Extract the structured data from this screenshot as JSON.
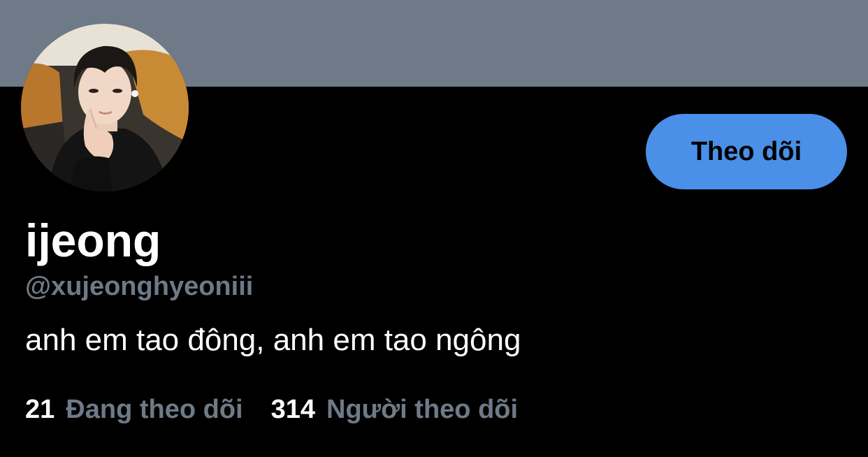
{
  "profile": {
    "display_name": "ijeong",
    "handle": "@xujeonghyeoniii",
    "bio": "anh em tao đông, anh em tao ngông",
    "follow_button_label": "Theo dõi",
    "following_count": "21",
    "following_label": "Đang theo dõi",
    "followers_count": "314",
    "followers_label": "Người theo dõi"
  },
  "colors": {
    "banner": "#6e7a87",
    "background": "#000000",
    "accent_button": "#4a8fe8",
    "muted_text": "#6e7a87",
    "primary_text": "#ffffff"
  },
  "icons": {
    "avatar": "profile-photo"
  }
}
